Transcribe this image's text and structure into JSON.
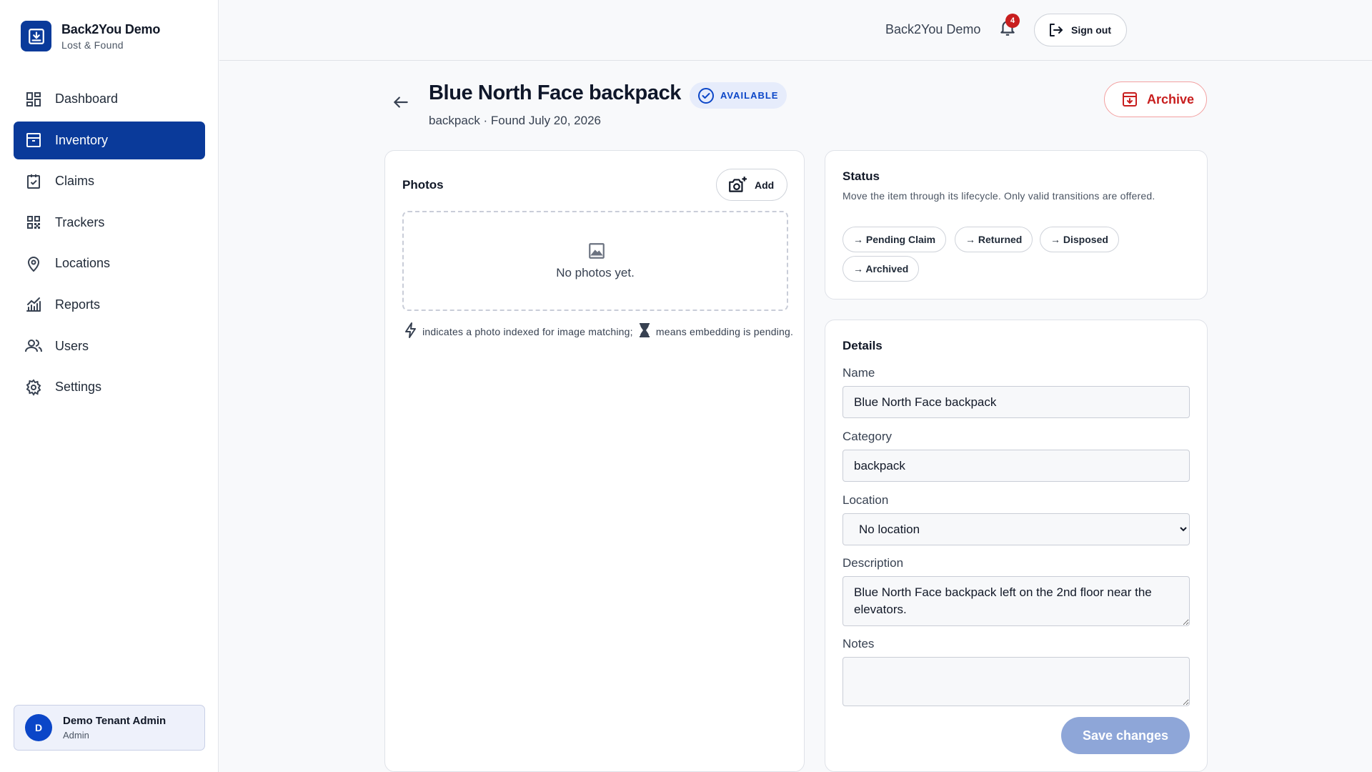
{
  "brand": {
    "name": "Back2You Demo",
    "subtitle": "Lost & Found"
  },
  "sidebar": {
    "items": [
      {
        "label": "Dashboard",
        "icon": "dashboard-icon"
      },
      {
        "label": "Inventory",
        "icon": "archive-box-icon",
        "active": true
      },
      {
        "label": "Claims",
        "icon": "clipboard-check-icon"
      },
      {
        "label": "Trackers",
        "icon": "qr-code-icon"
      },
      {
        "label": "Locations",
        "icon": "map-pin-icon"
      },
      {
        "label": "Reports",
        "icon": "chart-icon"
      },
      {
        "label": "Users",
        "icon": "users-icon"
      },
      {
        "label": "Settings",
        "icon": "gear-icon"
      }
    ],
    "user": {
      "initial": "D",
      "name": "Demo Tenant Admin",
      "role": "Admin"
    }
  },
  "header": {
    "tenant": "Back2You Demo",
    "notifications": "4",
    "sign_out": "Sign out"
  },
  "item": {
    "title": "Blue North Face backpack",
    "status_badge": "AVAILABLE",
    "subtitle": "backpack · Found July 20, 2026",
    "archive_label": "Archive"
  },
  "photos": {
    "title": "Photos",
    "add_label": "Add",
    "empty": "No photos yet.",
    "legend_part1": "indicates a photo indexed for image matching;",
    "legend_part2": "means embedding is pending."
  },
  "status": {
    "title": "Status",
    "description": "Move the item through its lifecycle. Only valid transitions are offered.",
    "transitions": [
      "→ Pending Claim",
      "→ Returned",
      "→ Disposed",
      "→ Archived"
    ]
  },
  "details": {
    "title": "Details",
    "name_label": "Name",
    "name_value": "Blue North Face backpack",
    "category_label": "Category",
    "category_value": "backpack",
    "location_label": "Location",
    "location_value": "No location",
    "description_label": "Description",
    "description_value": "Blue North Face backpack left on the 2nd floor near the elevators.",
    "notes_label": "Notes",
    "notes_value": "",
    "save_label": "Save changes"
  },
  "colors": {
    "primary": "#0a3a9a",
    "accent_blue": "#0b46c8",
    "danger": "#c81e1e",
    "save_disabled": "#8ea6d8"
  }
}
